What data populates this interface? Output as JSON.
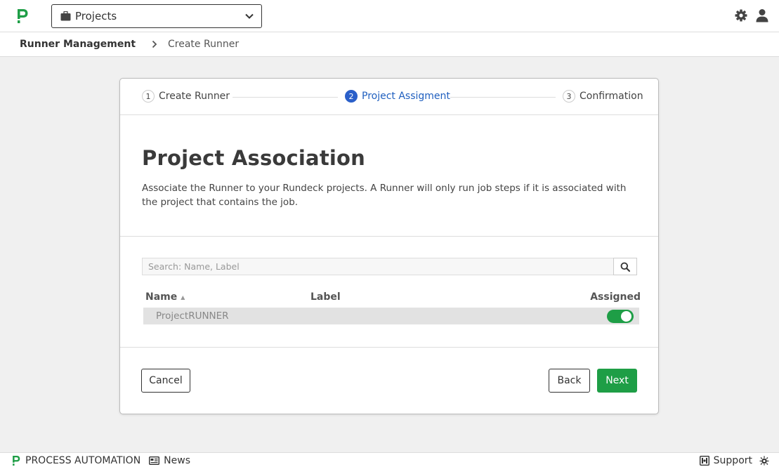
{
  "header": {
    "project_selector": "Projects"
  },
  "breadcrumb": {
    "root": "Runner Management",
    "current": "Create Runner"
  },
  "wizard": {
    "steps": [
      {
        "number": "1",
        "label": "Create Runner",
        "active": false
      },
      {
        "number": "2",
        "label": "Project Assigment",
        "active": true
      },
      {
        "number": "3",
        "label": "Confirmation",
        "active": false
      }
    ],
    "title": "Project Association",
    "description": "Associate the Runner to your Rundeck projects. A Runner will only run job steps if it is associated with the project that contains the job.",
    "search": {
      "placeholder": "Search: Name, Label",
      "value": ""
    },
    "table": {
      "columns": {
        "name": "Name",
        "label": "Label",
        "assigned": "Assigned"
      },
      "rows": [
        {
          "name": "ProjectRUNNER",
          "label": "",
          "assigned": true
        }
      ]
    },
    "buttons": {
      "cancel": "Cancel",
      "back": "Back",
      "next": "Next"
    }
  },
  "footer": {
    "brand": "PROCESS AUTOMATION",
    "news": "News",
    "support": "Support"
  },
  "colors": {
    "brand_green": "#1e9e46",
    "active_step_blue": "#2a5fc9"
  },
  "icons": [
    "pagerduty-logo-icon",
    "briefcase-icon",
    "chevron-down-icon",
    "gear-icon",
    "user-icon",
    "chevron-right-icon",
    "search-icon",
    "sort-asc-icon",
    "newspaper-icon",
    "support-icon",
    "bug-icon"
  ]
}
